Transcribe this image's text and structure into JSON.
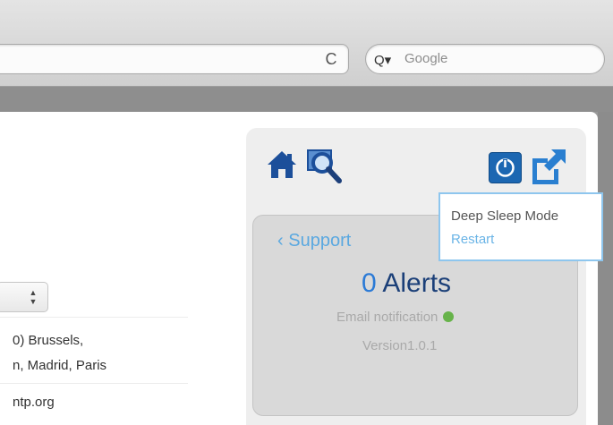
{
  "browser": {
    "reload_glyph": "C",
    "search_placeholder": "Google",
    "search_icon_glyph": "Q▾"
  },
  "sidebar": {
    "support_label": "Support",
    "alerts_count": "0",
    "alerts_label": "Alerts",
    "email_notification_label": "Email notification",
    "version_label": "Version1.0.1",
    "icons": [
      "home-icon",
      "magnify-icon",
      "power-icon",
      "external-link-icon"
    ]
  },
  "tooltip": {
    "deep_sleep_label": "Deep Sleep Mode",
    "restart_label": "Restart"
  },
  "left": {
    "dropdown_chevrons": "▲▼",
    "timezone_line1": "0) Brussels,",
    "timezone_line2": "n, Madrid, Paris",
    "ntp_server": "ntp.org"
  },
  "colors": {
    "accent_blue": "#1c67b2",
    "link_blue": "#5aa8e0",
    "status_green": "#67b34a"
  }
}
